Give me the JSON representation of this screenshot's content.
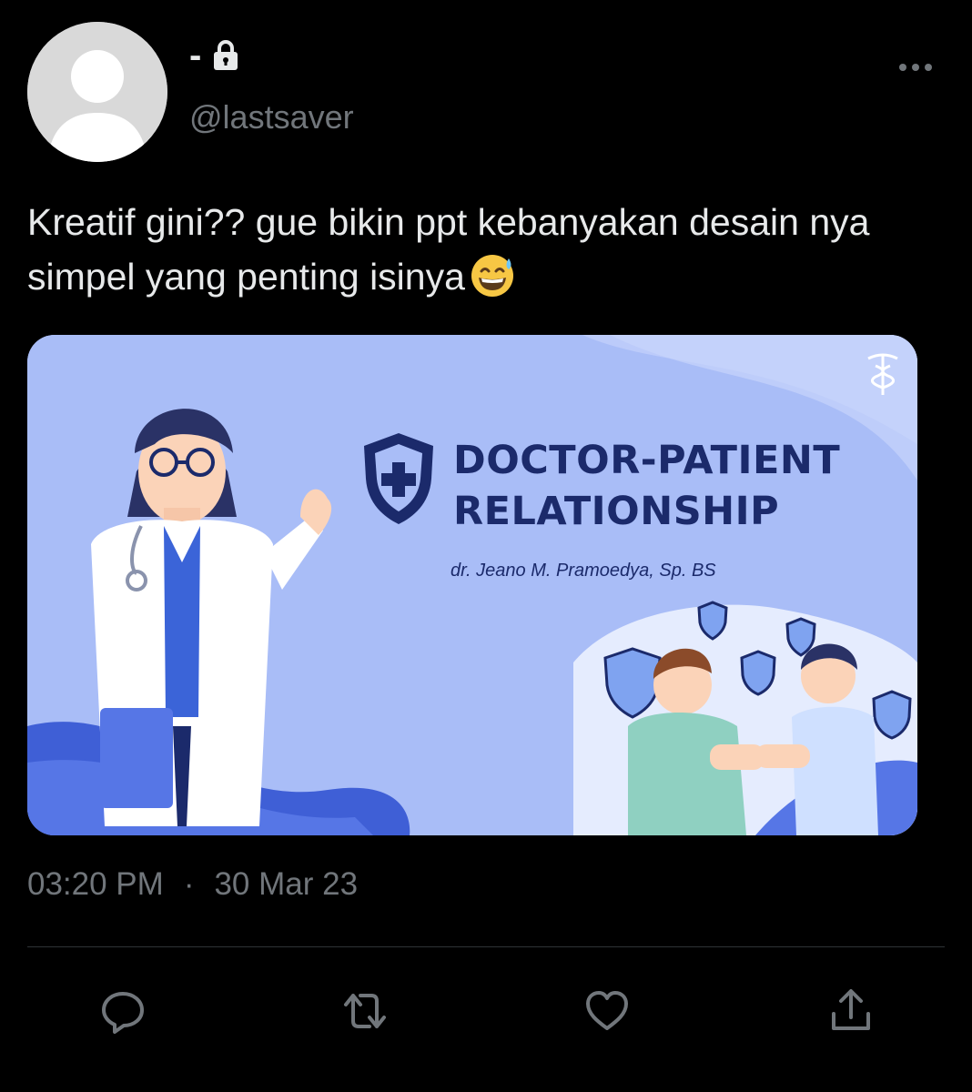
{
  "tweet": {
    "author": {
      "display_name": "-",
      "handle": "@lastsaver",
      "protected": true
    },
    "text": "Kreatif gini?? gue bikin ppt kebanyakan desain nya simpel yang penting isinya",
    "emoji": "grinning-face-with-sweat",
    "media": {
      "slide_title_line1": "DOCTOR-PATIENT",
      "slide_title_line2": "RELATIONSHIP",
      "slide_subtitle": "dr. Jeano M. Pramoedya, Sp. BS"
    },
    "time": "03:20 PM",
    "separator": "·",
    "date": "30 Mar 23"
  },
  "actions": {
    "reply": "reply-icon",
    "retweet": "retweet-icon",
    "like": "heart-icon",
    "share": "share-icon"
  },
  "colors": {
    "background": "#000000",
    "text_primary": "#e7e9ea",
    "text_secondary": "#71767b",
    "slide_navy": "#1b2a6b",
    "slide_blue": "#a9bdf7"
  }
}
